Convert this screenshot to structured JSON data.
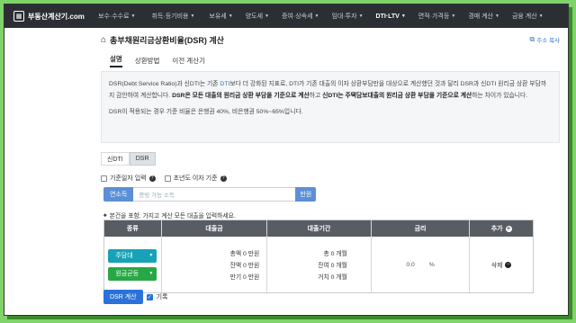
{
  "brand": {
    "name": "부동산계산기.com",
    "logo_icon": "building-icon"
  },
  "nav": [
    {
      "label": "보수·수수료",
      "active": false
    },
    {
      "label": "취득·등기비용",
      "active": false
    },
    {
      "label": "보유세",
      "active": false
    },
    {
      "label": "양도세",
      "active": false
    },
    {
      "label": "증여·상속세",
      "active": false
    },
    {
      "label": "임대·투자",
      "active": false
    },
    {
      "label": "DTI·LTV",
      "active": true
    },
    {
      "label": "면적·가격등",
      "active": false
    },
    {
      "label": "경매 계산",
      "active": false
    },
    {
      "label": "금융 계산",
      "active": false
    }
  ],
  "page": {
    "title": "총부채원리금상환비율(DSR) 계산",
    "copy_label": "주소 복사"
  },
  "tabs": [
    "설명",
    "상환방법",
    "이전 계산기"
  ],
  "info": {
    "p1_a": "DSR(Debt Service Ratio)과 신DTI는 기존 ",
    "p1_dti": "DTI",
    "p1_b": "보다 더 강화된 지표로, DTI가 기존 대출의 이자 상환부담만을 대상으로 계산했던 것과 달리 DSR과 신DTI 원리금 상환 부담까지 감안하여 계산합니다. ",
    "p1_bold1": "DSR은 모든 대출의 원리금 상환 부담을 기준으로 계산",
    "p1_c": "하고 ",
    "p1_bold2": "신DTI는 주택담보대출의 원리금 상환 부담을 기준으로 계산",
    "p1_d": "하는 차이가 있습니다.",
    "p2": "DSR이 적용되는 경우 기준 비율은 은행권 40%, 비은행권 50%~65%입니다."
  },
  "mode_tabs": [
    {
      "label": "신DTI",
      "active": false
    },
    {
      "label": "DSR",
      "active": true
    }
  ],
  "options": {
    "base_date": "기준일자 입력",
    "first_year": "초년도 이자 기준"
  },
  "income": {
    "label": "연소득",
    "placeholder": "증빙 가능 소득",
    "unit": "만원"
  },
  "note": "본건을 포함, 가지고 계산 모든 대출을 입력하세요.",
  "table": {
    "headers": [
      "종류",
      "대출금",
      "대출기간",
      "금리",
      "추가"
    ],
    "rows": [
      {
        "type": "주담대",
        "repay": "원금균등",
        "amounts": [
          "총액 0 만원",
          "잔액 0 만원",
          "만기 0 만원"
        ],
        "periods": [
          "총 0 개월",
          "잔여 0 개월",
          "거치 0 개월"
        ],
        "rate": "0.0",
        "rate_unit": "%",
        "delete": "삭제"
      }
    ]
  },
  "calc_button": "DSR 계산",
  "record_label": "기록",
  "colors": {
    "accent": "#2a72d8",
    "teal": "#17a2b8",
    "green": "#28a745",
    "nav_bg": "#2b2f33"
  }
}
